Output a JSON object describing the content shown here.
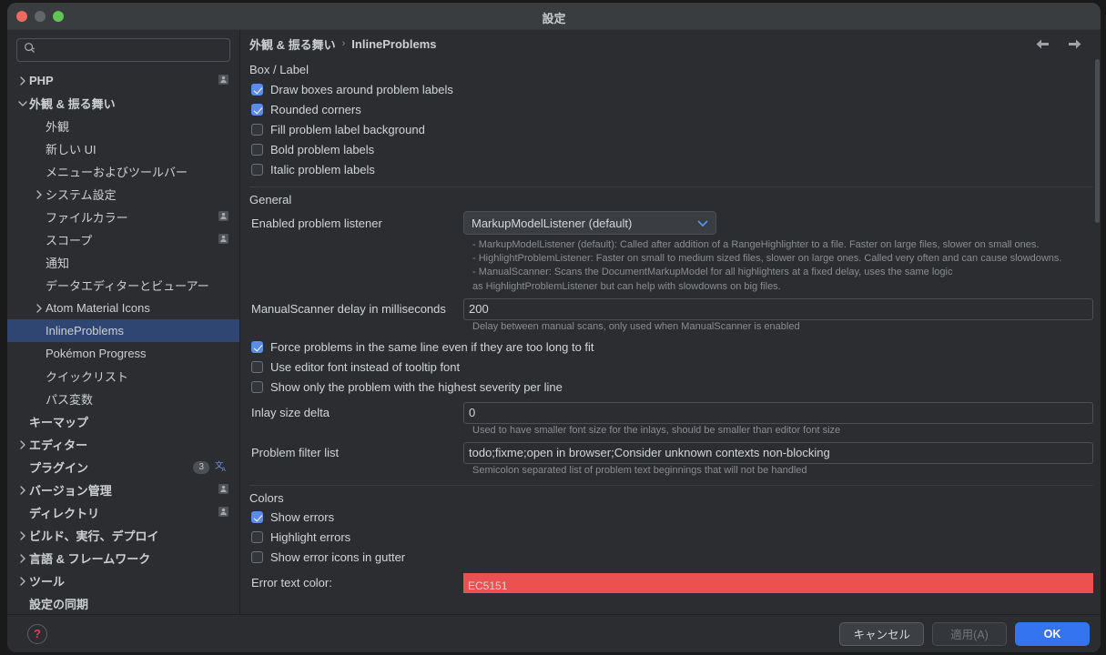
{
  "window": {
    "title": "設定",
    "traffic_lights": [
      "close",
      "minimize",
      "zoom"
    ]
  },
  "sidebar": {
    "search": {
      "value": "",
      "placeholder": ""
    },
    "items": [
      {
        "label": "PHP",
        "indent": 0,
        "arrow": "right",
        "bold": true,
        "person": true
      },
      {
        "label": "外観 & 振る舞い",
        "indent": 0,
        "arrow": "down",
        "bold": true,
        "person": false
      },
      {
        "label": "外観",
        "indent": 1,
        "arrow": "",
        "bold": false,
        "person": false
      },
      {
        "label": "新しい UI",
        "indent": 1,
        "arrow": "",
        "bold": false,
        "person": false
      },
      {
        "label": "メニューおよびツールバー",
        "indent": 1,
        "arrow": "",
        "bold": false,
        "person": false
      },
      {
        "label": "システム設定",
        "indent": 1,
        "arrow": "right",
        "bold": false,
        "person": false
      },
      {
        "label": "ファイルカラー",
        "indent": 1,
        "arrow": "",
        "bold": false,
        "person": true
      },
      {
        "label": "スコープ",
        "indent": 1,
        "arrow": "",
        "bold": false,
        "person": true
      },
      {
        "label": "通知",
        "indent": 1,
        "arrow": "",
        "bold": false,
        "person": false
      },
      {
        "label": "データエディターとビューアー",
        "indent": 1,
        "arrow": "",
        "bold": false,
        "person": false
      },
      {
        "label": "Atom Material Icons",
        "indent": 1,
        "arrow": "right",
        "bold": false,
        "person": false
      },
      {
        "label": "InlineProblems",
        "indent": 1,
        "arrow": "",
        "bold": false,
        "person": false,
        "selected": true
      },
      {
        "label": "Pokémon Progress",
        "indent": 1,
        "arrow": "",
        "bold": false,
        "person": false
      },
      {
        "label": "クイックリスト",
        "indent": 1,
        "arrow": "",
        "bold": false,
        "person": false
      },
      {
        "label": "パス変数",
        "indent": 1,
        "arrow": "",
        "bold": false,
        "person": false
      },
      {
        "label": "キーマップ",
        "indent": 0,
        "arrow": "",
        "bold": true,
        "person": false
      },
      {
        "label": "エディター",
        "indent": 0,
        "arrow": "right",
        "bold": true,
        "person": false
      },
      {
        "label": "プラグイン",
        "indent": 0,
        "arrow": "",
        "bold": true,
        "person": false,
        "count": "3",
        "translate": true
      },
      {
        "label": "バージョン管理",
        "indent": 0,
        "arrow": "right",
        "bold": true,
        "person": true
      },
      {
        "label": "ディレクトリ",
        "indent": 0,
        "arrow": "",
        "bold": true,
        "person": true
      },
      {
        "label": "ビルド、実行、デプロイ",
        "indent": 0,
        "arrow": "right",
        "bold": true,
        "person": false
      },
      {
        "label": "言語 & フレームワーク",
        "indent": 0,
        "arrow": "right",
        "bold": true,
        "person": false
      },
      {
        "label": "ツール",
        "indent": 0,
        "arrow": "right",
        "bold": true,
        "person": false
      },
      {
        "label": "設定の同期",
        "indent": 0,
        "arrow": "",
        "bold": true,
        "person": false
      }
    ]
  },
  "breadcrumb": {
    "parent": "外観 & 振る舞い",
    "separator": "›",
    "current": "InlineProblems"
  },
  "main": {
    "section_box_label": "Box / Label",
    "box_checkboxes": [
      {
        "label": "Draw boxes around problem labels",
        "checked": true
      },
      {
        "label": "Rounded corners",
        "checked": true
      },
      {
        "label": "Fill problem label background",
        "checked": false
      },
      {
        "label": "Bold problem labels",
        "checked": false
      },
      {
        "label": "Italic problem labels",
        "checked": false
      }
    ],
    "section_general_label": "General",
    "listener": {
      "label": "Enabled problem listener",
      "value": "MarkupModelListener (default)",
      "hints": [
        "- MarkupModelListener (default): Called after addition of a RangeHighlighter to a file. Faster on large files, slower on small ones.",
        "- HighlightProblemListener: Faster on small to medium sized files, slower on large ones. Called very often and can cause slowdowns.",
        "- ManualScanner: Scans the DocumentMarkupModel for all highlighters at a fixed delay, uses the same logic",
        "as HighlightProblemListener but can help with slowdowns on big files."
      ]
    },
    "manual_delay": {
      "label": "ManualScanner delay in milliseconds",
      "value": "200",
      "hint": "Delay between manual scans, only used when ManualScanner is enabled"
    },
    "general_checkboxes": [
      {
        "label": "Force problems in the same line even if they are too long to fit",
        "checked": true
      },
      {
        "label": "Use editor font instead of tooltip font",
        "checked": false
      },
      {
        "label": "Show only the problem with the highest severity per line",
        "checked": false
      }
    ],
    "inlay_delta": {
      "label": "Inlay size delta",
      "value": "0",
      "hint": "Used to have smaller font size for the inlays, should be smaller than editor font size"
    },
    "problem_filter": {
      "label": "Problem filter list",
      "value": "todo;fixme;open in browser;Consider unknown contexts non-blocking",
      "hint": "Semicolon separated list of problem text beginnings that will not be handled"
    },
    "section_colors_label": "Colors",
    "color_checkboxes": [
      {
        "label": "Show errors",
        "checked": true
      },
      {
        "label": "Highlight errors",
        "checked": false
      },
      {
        "label": "Show error icons in gutter",
        "checked": false
      }
    ],
    "error_color": {
      "label": "Error text color:",
      "value": "EC5151",
      "swatch": "#EC5151"
    }
  },
  "footer": {
    "help_label": "?",
    "cancel_label": "キャンセル",
    "apply_label": "適用(A)",
    "ok_label": "OK"
  },
  "colors": {
    "accent": "#3574f0",
    "selection": "#2f4673",
    "checkbox_on": "#5a8ce8",
    "error": "#EC5151",
    "panel_bg": "#2b2d30"
  }
}
